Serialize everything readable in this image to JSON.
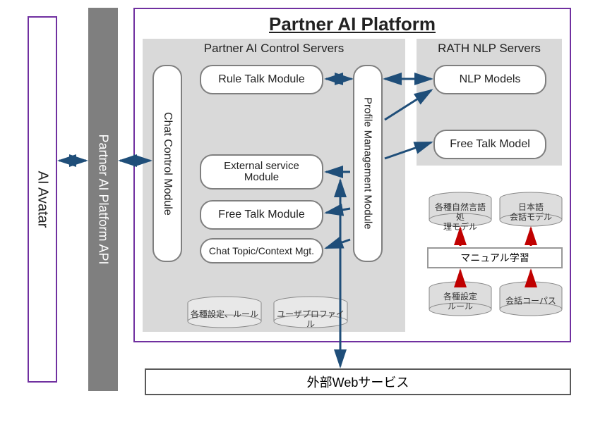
{
  "title": "Partner AI Platform",
  "avatar_label": "AI Avatar",
  "api_label": "Partner AI Platform API",
  "controlServers": {
    "title": "Partner AI Control Servers",
    "chat_control": "Chat Control Module",
    "rule_talk": "Rule Talk Module",
    "external_service": "External service\nModule",
    "free_talk": "Free Talk Module",
    "chat_topic": "Chat Topic/Context Mgt.",
    "profile_mgmt": "Profile Management Module",
    "db_settings": "各種設定、ルール",
    "db_profile": "ユーザプロファイル"
  },
  "nlpServers": {
    "title": "RATH NLP Servers",
    "nlp_models": "NLP Models",
    "free_talk_model": "Free Talk Model"
  },
  "learning": {
    "manual_learning": "マニュアル学習",
    "db_nlp_model": "各種自然言語処\n理モデル",
    "db_jp_model": "日本語\n会話モデル",
    "db_settings_rules": "各種設定\nルール",
    "db_corpus": "会話コーパス"
  },
  "external_services": "外部Webサービス"
}
